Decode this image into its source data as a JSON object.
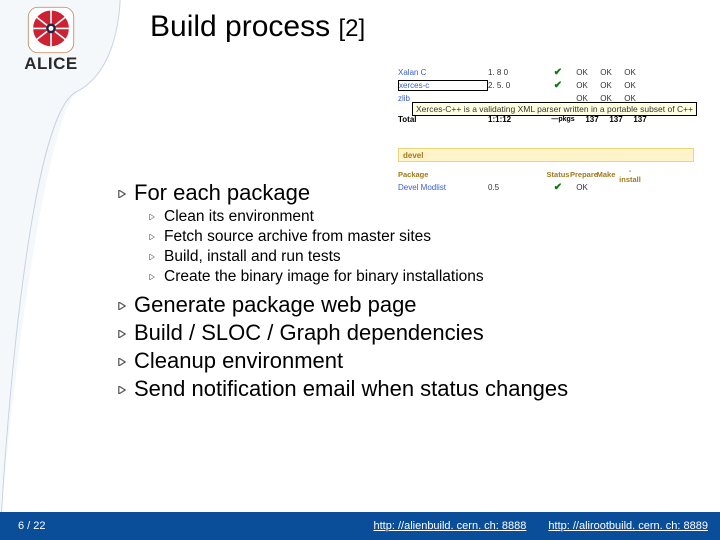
{
  "logo": {
    "text": "ALICE"
  },
  "title": {
    "main": "Build process ",
    "sub": "[2]"
  },
  "bullets": {
    "b1": "For each package",
    "b1_items": [
      "Clean its environment",
      "Fetch source archive from master sites",
      "Build, install and run tests",
      "Create the binary image for binary installations"
    ],
    "b2": "Generate package web page",
    "b3": "Build / SLOC / Graph dependencies",
    "b4": "Cleanup environment",
    "b5": "Send notification email when status changes"
  },
  "table": {
    "rows_top": [
      {
        "name": "Xalan C",
        "ver": "1. 8 0",
        "st": "✔",
        "c": [
          "OK",
          "OK",
          "OK"
        ]
      },
      {
        "name": "xerces-c",
        "ver": "2. 5. 0",
        "st": "✔",
        "c": [
          "OK",
          "OK",
          "OK"
        ]
      },
      {
        "name": "zlib",
        "ver": "",
        "st": "",
        "c": [
          "OK",
          "OK",
          "OK"
        ]
      }
    ],
    "total": {
      "name": "Total",
      "ver": "1:1:12",
      "pkgs": "—pkgs",
      "c": [
        "137",
        "137",
        "137"
      ]
    },
    "tooltip": "Xerces-C++ is a validating XML parser written in a portable subset of C++",
    "section": "devel",
    "headers": [
      "Package",
      "",
      "Status",
      "Prepare",
      "Make",
      "-install"
    ],
    "rows_dev": [
      {
        "name": "Devel Modlist",
        "ver": "0.5",
        "st": "✔",
        "c": [
          "OK",
          "",
          ""
        ]
      }
    ]
  },
  "footer": {
    "page": "6 / 22",
    "link1": "http: //alienbuild. cern. ch: 8888",
    "link2": "http: //alirootbuild. cern. ch: 8889"
  }
}
